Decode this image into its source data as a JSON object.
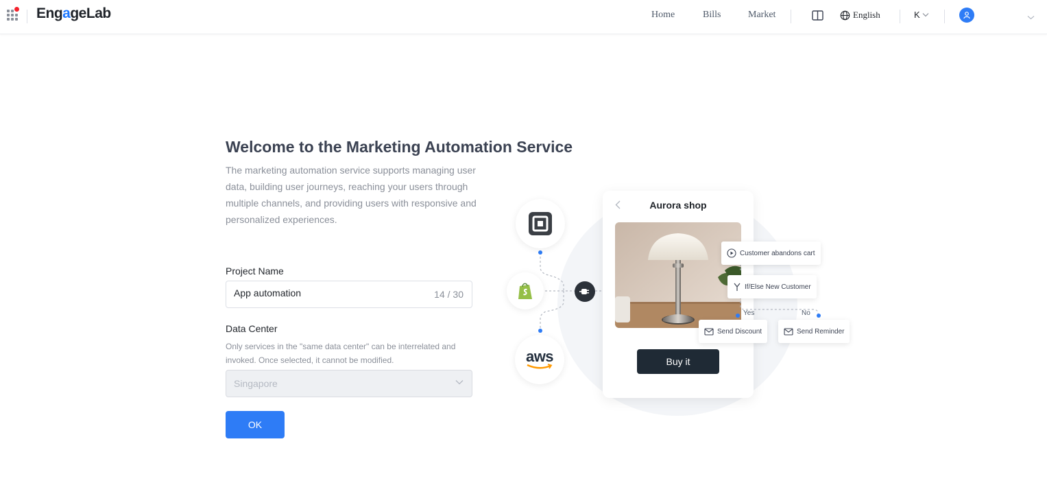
{
  "header": {
    "logo_text_prefix": "Eng",
    "logo_text_accent": "a",
    "logo_text_middle": "ge",
    "logo_text_suffix": "Lab",
    "nav": [
      {
        "label": "Home"
      },
      {
        "label": "Bills"
      },
      {
        "label": "Market"
      }
    ],
    "language": "English",
    "user_initial": "K"
  },
  "main": {
    "title": "Welcome to the Marketing Automation Service",
    "description": "The marketing automation service supports managing user data, building user journeys, reaching your users through multiple channels, and providing users with responsive and personalized experiences.",
    "project_name_label": "Project Name",
    "project_name_value": "App automation",
    "project_name_counter": "14 / 30",
    "data_center_label": "Data Center",
    "data_center_hint": "Only services in the \"same data center\" can be interrelated and invoked. Once selected, it cannot be modified.",
    "data_center_value": "Singapore",
    "ok_label": "OK"
  },
  "illustration": {
    "integrations": [
      "square-icon",
      "shopify-icon",
      "aws-logo"
    ],
    "aws_text": "aws",
    "shop_title": "Aurora shop",
    "buy_label": "Buy it",
    "flow_trigger": "Customer abandons cart",
    "flow_condition": "If/Else New Customer",
    "flow_yes": "Yes",
    "flow_no": "No",
    "flow_action_yes": "Send Discount",
    "flow_action_no": "Send Reminder"
  },
  "colors": {
    "primary": "#2e7cf6",
    "title": "#3b4252",
    "muted": "#8a8f99",
    "dark_button": "#1f2a35",
    "notification_dot": "#f5222d"
  }
}
